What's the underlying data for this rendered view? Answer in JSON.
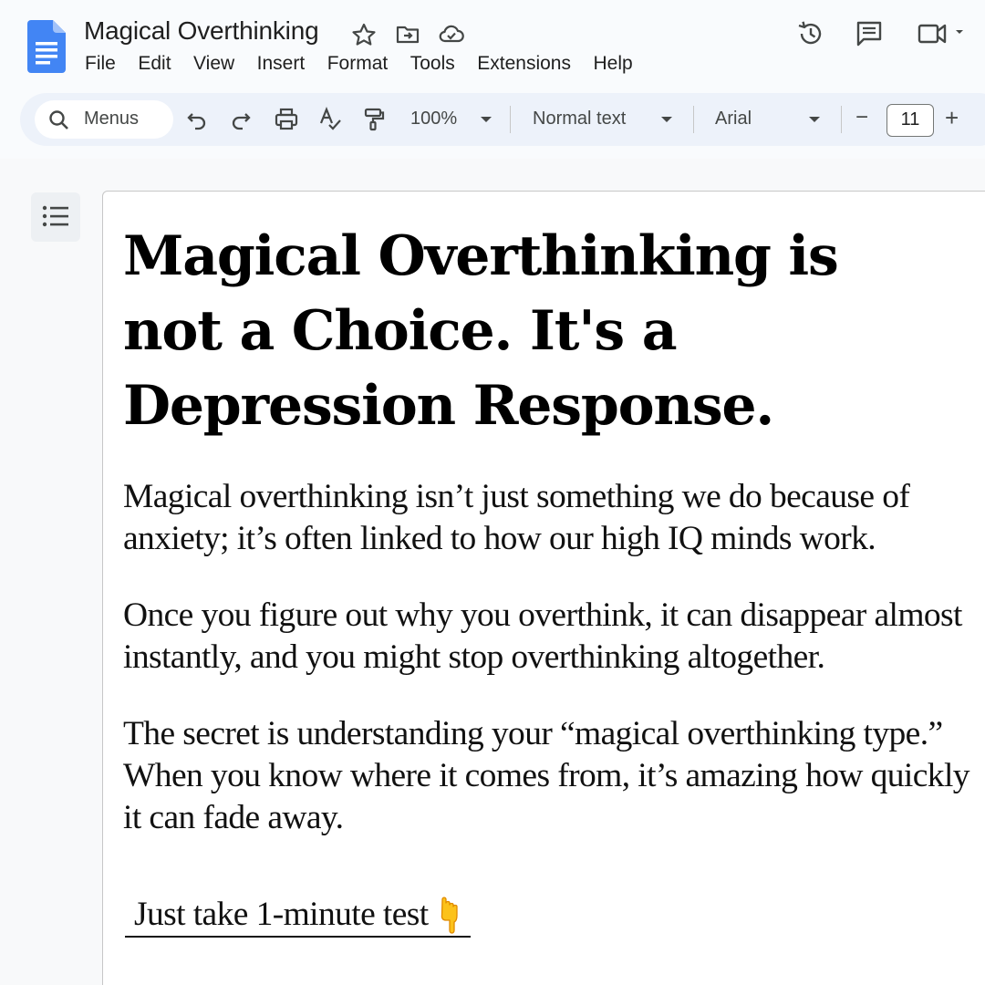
{
  "app": {
    "document_title": "Magical Overthinking",
    "menu": [
      "File",
      "Edit",
      "View",
      "Insert",
      "Format",
      "Tools",
      "Extensions",
      "Help"
    ],
    "title_icons": [
      "star-icon",
      "move-to-folder-icon",
      "cloud-saved-icon"
    ],
    "right_icons": [
      "version-history-icon",
      "comments-icon",
      "meet-video-icon"
    ]
  },
  "toolbar": {
    "search_label": "Menus",
    "zoom": "100%",
    "style": "Normal text",
    "font": "Arial",
    "font_size": "11",
    "decrease_label": "−",
    "increase_label": "+"
  },
  "document": {
    "heading": "Magical Overthinking is not a Choice. It's a Depression Response.",
    "paragraphs": [
      "Magical overthinking isn’t just something we do because of anxiety; it’s often linked to how our high IQ minds work.",
      "Once you figure out why you overthink, it can disappear almost instantly, and you might stop overthinking altogether.",
      "The secret is understanding your “magical overthinking type.” When you know where it comes from, it’s amazing how quickly it can fade away."
    ],
    "cta": "Just take 1-minute test"
  },
  "colors": {
    "docs_blue": "#4285f4",
    "toolbar_bg": "#edf2fa",
    "text": "#1f1f1f"
  }
}
